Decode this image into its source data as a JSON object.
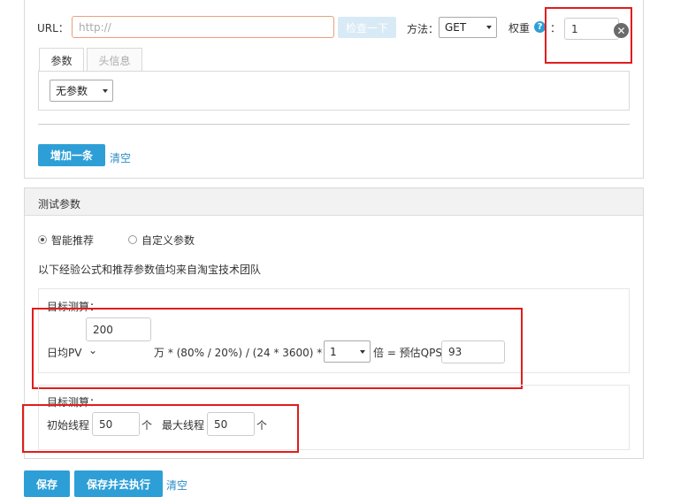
{
  "url_section": {
    "url_label": "URL：",
    "url_placeholder": "http://",
    "test_button": "检查一下",
    "method_label": "方法：",
    "method_value": "GET",
    "weight_label": "权重",
    "weight_colon": "：",
    "weight_value": "1",
    "tabs": [
      {
        "label": "参数"
      },
      {
        "label": "头信息"
      }
    ],
    "param_select": "无参数",
    "add_button": "增加一条",
    "clear_link": "清空"
  },
  "test_params": {
    "title": "测试参数",
    "radio_smart": "智能推荐",
    "radio_custom": "自定义参数",
    "info": "以下经验公式和推荐参数值均来自淘宝技术团队",
    "box1": {
      "heading": "目标测算：",
      "pv_label": "日均PV",
      "pv_value": "200",
      "formula": "万 * (80% / 20%) / (24 * 3600) *",
      "multiplier": "1",
      "result_label": "倍 = 预估QPS",
      "qps": "93"
    },
    "box2": {
      "heading": "目标测算：",
      "initial_label": "初始线程",
      "initial_value": "50",
      "unit1": "个",
      "max_label": "最大线程",
      "max_value": "50",
      "unit2": "个"
    }
  },
  "footer": {
    "save": "保存",
    "save_run": "保存并去执行",
    "clear": "清空"
  },
  "colors": {
    "accent": "#2e9fd6",
    "highlight": "#e01d1d",
    "url_border": "#e8a07c"
  }
}
